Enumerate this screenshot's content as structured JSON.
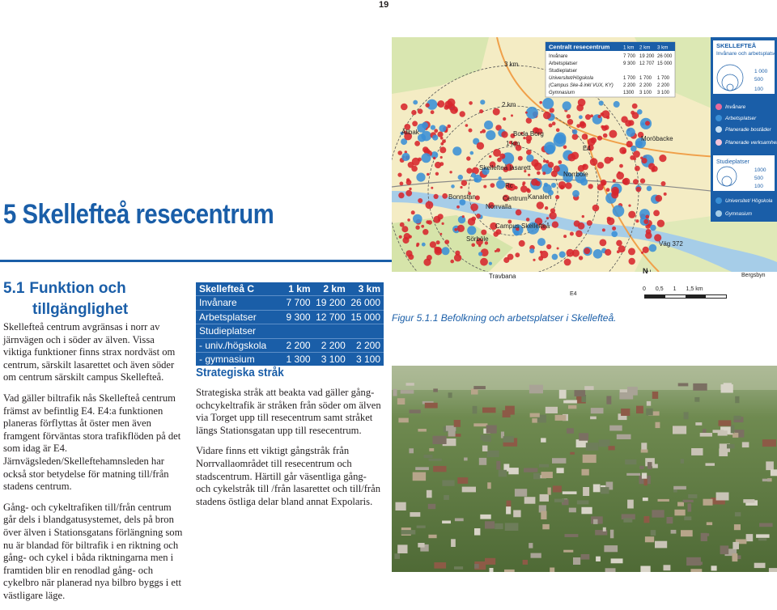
{
  "page_number": "19",
  "chapter": {
    "number": "5",
    "title": "Skellefteå resecentrum"
  },
  "section": {
    "number": "5.1",
    "title_line1": "Funktion och",
    "title_line2": "tillgänglighet"
  },
  "left_paragraphs": [
    "Skellefteå centrum avgränsas i norr av järnvägen och i söder av älven. Vissa viktiga funktioner finns strax nordväst om centrum, särskilt lasarettet och även söder om centrum särskilt campus Skellefteå.",
    "Vad gäller biltrafik nås Skellefteå centrum främst av befintlig E4. E4:a funktionen planeras förflyttas åt öster men även framgent förväntas stora trafikflöden på det som idag är E4. Järnvägsleden/Skelleftehamnsleden har också stor betydelse för matning till/från stadens centrum.",
    "Gång- och cykeltrafiken till/från centrum går dels i blandgatusystemet, dels på bron över älven i Stationsgatans förlängning som nu är blandad för biltrafik i en riktning och gång- och cykel i båda riktningarna men i framtiden blir en renodlad gång- och cykelbro när planerad nya bilbro byggs i ett västligare läge."
  ],
  "table": {
    "headers": [
      "Skellefteå C",
      "1 km",
      "2 km",
      "3 km"
    ],
    "rows": [
      [
        "Invånare",
        "7 700",
        "19 200",
        "26 000"
      ],
      [
        "Arbetsplatser",
        "9 300",
        "12 700",
        "15 000"
      ],
      [
        "Studieplatser",
        "",
        "",
        ""
      ],
      [
        "- univ./högskola",
        "2 200",
        "2 200",
        "2 200"
      ],
      [
        "- gymnasium",
        "1 300",
        "3 100",
        "3 100"
      ]
    ]
  },
  "subsection_title": "Strategiska stråk",
  "mid_paragraphs": [
    "Strategiska stråk att beakta vad gäller gång-ochcykeltrafik är stråken från söder om älven via Torget upp till resecentrum samt stråket längs Stationsgatan upp till resecentrum.",
    "Vidare finns  ett viktigt gångstråk från Norrvallaområdet till resecentrum och stadscentrum. Härtill går väsentliga gång- och cykelstråk till /från lasarettet och till/från stadens östliga delar bland annat Expolaris."
  ],
  "map": {
    "inset_title": "Centralt resecentrum",
    "inset_headers": [
      "1 km",
      "2 km",
      "3 km"
    ],
    "inset_rows": [
      [
        "Invånare",
        "7 700",
        "19 200",
        "26 000"
      ],
      [
        "Arbetsplatser",
        "9 300",
        "12 707",
        "15 000"
      ],
      [
        "Studieplatser",
        "",
        "",
        ""
      ],
      [
        "Universitet/Högskola",
        "1 700",
        "1 700",
        "1 700"
      ],
      [
        "(Campus Ske-å inkl VUX, KY)",
        "2 200",
        "2 200",
        "2 200"
      ],
      [
        "Gymnasium",
        "1300",
        "3 100",
        "3 100"
      ]
    ],
    "ring_labels": [
      "3 km",
      "2 km",
      "1 km"
    ],
    "place_labels": [
      "Ålibak",
      "Boda Borg",
      "Moröbacke",
      "Skellefteå lasarett",
      "Centrum",
      "Norrböle",
      "Kanalen",
      "Bonnstan",
      "Norrvalla",
      "Campus Skellefteå",
      "Sörböle",
      "Travbana",
      "Rc",
      "E4",
      "Väg 372",
      "Bergsbyn",
      "N"
    ],
    "scale": [
      "0",
      "0,5",
      "1",
      "1,5 km"
    ],
    "legend_title": "SKELLEFTEÅ",
    "legend_subtitle": "Invånare och arbetsplatser",
    "legend_values": [
      "1 000",
      "500",
      "100"
    ],
    "legend_items": [
      "Invånare",
      "Arbetsplatser",
      "Planerade bostäder",
      "Planerade verksamhetsområden"
    ],
    "legend_study_title": "Studieplatser",
    "legend_study_values": [
      "1000",
      "500",
      "100"
    ],
    "legend_study_items": [
      "Universitet/ Högskola",
      "Gymnasium"
    ],
    "colors": {
      "resident": "#3a8fd6",
      "workplace": "#d7262c",
      "bg": "#f6efc8",
      "river": "#9fc9e6"
    }
  },
  "figure_caption": "Figur 5.1.1 Befolkning och arbetsplatser i Skellefteå."
}
